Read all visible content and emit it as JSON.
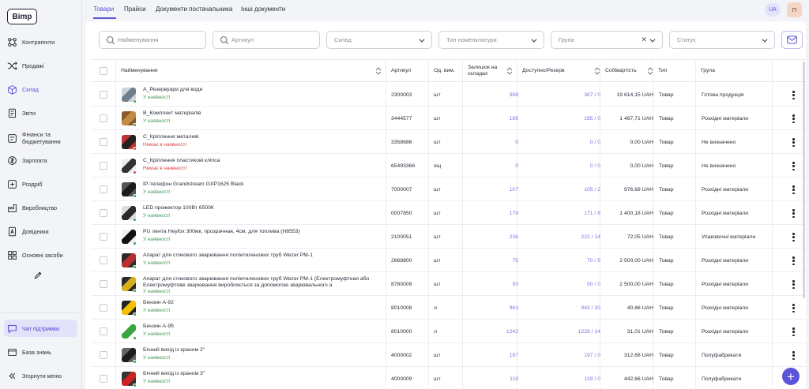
{
  "app": {
    "logo": "Bimp"
  },
  "sidebar": {
    "items": [
      {
        "label": "Контрагенти",
        "icon": "users-network-icon"
      },
      {
        "label": "Продажі",
        "icon": "shuffle-icon"
      },
      {
        "label": "Склад",
        "icon": "box-icon"
      },
      {
        "label": "Звіти",
        "icon": "report-icon"
      },
      {
        "label": "Фінанси та бюджетування",
        "icon": "finance-icon"
      },
      {
        "label": "Зарплата",
        "icon": "salary-icon"
      },
      {
        "label": "Роздріб",
        "icon": "retail-icon"
      },
      {
        "label": "Виробництво",
        "icon": "production-icon"
      },
      {
        "label": "Довідники",
        "icon": "directory-icon"
      },
      {
        "label": "Основні засоби",
        "icon": "assets-icon"
      }
    ],
    "bottom": [
      {
        "label": "Чат підтримки",
        "icon": "chat-icon"
      },
      {
        "label": "База знань",
        "icon": "knowledge-icon"
      },
      {
        "label": "Згорнути меню",
        "icon": "collapse-icon"
      }
    ]
  },
  "tabs": [
    "Товари",
    "Прайси",
    "Документи постачальника",
    "Інші документи"
  ],
  "header": {
    "lang": "UA",
    "avatar": "П"
  },
  "filters": {
    "name_placeholder": "Найменування",
    "sku_placeholder": "Артикул",
    "warehouse": "Склад",
    "nomenclature_type": "Тип номенклатури",
    "group": "Група",
    "status": "Статус"
  },
  "columns": {
    "name": "Найменування",
    "sku": "Артикул",
    "unit": "Од. вим.",
    "stock": "Залишок на складах",
    "available": "Доступно/Резерв",
    "cost": "Собівартість",
    "type": "Тип",
    "group": "Група"
  },
  "rows": [
    {
      "name": "A_Резервуари для води",
      "name2": "",
      "status": "У наявності",
      "in_stock": true,
      "sku": "2300003",
      "unit": "шт",
      "stock": "388",
      "avail": "387 / 0",
      "cost": "19 614,15 UAH",
      "type": "Товар",
      "group": "Готова продукція"
    },
    {
      "name": "B_Комплект матеріалів",
      "name2": "",
      "status": "У наявності",
      "in_stock": true,
      "sku": "3444577",
      "unit": "шт",
      "stock": "185",
      "avail": "185 / 0",
      "cost": "1 467,71 UAH",
      "type": "Товар",
      "group": "Розхідні матеріали"
    },
    {
      "name": "C_Кріплення металеві",
      "name2": "",
      "status": "Немає в наявності",
      "in_stock": false,
      "sku": "3358686",
      "unit": "шт",
      "stock": "0",
      "avail": "0 / 0",
      "cost": "0,00 UAH",
      "type": "Товар",
      "group": "Не визначено"
    },
    {
      "name": "C_Кріплення пластикові кліпса",
      "name2": "",
      "status": "Немає в наявності",
      "in_stock": false,
      "sku": "65493366",
      "unit": "ящ",
      "stock": "0",
      "avail": "0 / 0",
      "cost": "0,00 UAH",
      "type": "Товар",
      "group": "Не визначено"
    },
    {
      "name": "IP-телефон Grandstream GXP1625 Black",
      "name2": "",
      "status": "У наявності",
      "in_stock": true,
      "sku": "7000007",
      "unit": "шт",
      "stock": "107",
      "avail": "105 / 2",
      "cost": "976,68 UAH",
      "type": "Товар",
      "group": "Розхідні матеріали"
    },
    {
      "name": "LED прожектор 100Вт 6500К",
      "name2": "",
      "status": "У наявності",
      "in_stock": true,
      "sku": "0007850",
      "unit": "шт",
      "stock": "179",
      "avail": "171 / 8",
      "cost": "1 400,18 UAH",
      "type": "Товар",
      "group": "Розхідні матеріали"
    },
    {
      "name": "PU лента Heyfox 300мк, прозрачная, 4см, для топлива (H8553)",
      "name2": "",
      "status": "У наявності",
      "in_stock": true,
      "sku": "2100051",
      "unit": "шт",
      "stock": "236",
      "avail": "222 / 14",
      "cost": "72,05 UAH",
      "type": "Товар",
      "group": "Упаковочні матеріали"
    },
    {
      "name": "Апарат для стикового зварювання поліетиленових труб Wezer PM-1",
      "name2": "",
      "status": "У наявності",
      "in_stock": true,
      "sku": "2668800",
      "unit": "шт",
      "stock": "75",
      "avail": "70 / 5",
      "cost": "2 500,00 UAH",
      "type": "Товар",
      "group": "Розхідні матеріали"
    },
    {
      "name": "Апарат для стикового зварювання поліетиленових труб Wezer PM-1 (Електромуфтная або",
      "name2": "Електромуфтове зварювання виробляється за допомогою зварювального а",
      "status": "У наявності",
      "in_stock": true,
      "sku": "8780009",
      "unit": "шт",
      "stock": "50",
      "avail": "50 / 0",
      "cost": "2 500,00 UAH",
      "type": "Товар",
      "group": "Розхідні матеріали"
    },
    {
      "name": "Бензин А-92",
      "name2": "",
      "status": "У наявності",
      "in_stock": true,
      "sku": "8010008",
      "unit": "л",
      "stock": "963",
      "avail": "943 / 20",
      "cost": "40,86 UAH",
      "type": "Товар",
      "group": "Розхідні матеріали"
    },
    {
      "name": "Бензин А-95",
      "name2": "",
      "status": "У наявності",
      "in_stock": true,
      "sku": "8010000",
      "unit": "л",
      "stock": "1242",
      "avail": "1228 / 14",
      "cost": "31,01 UAH",
      "type": "Товар",
      "group": "Розхідні матеріали"
    },
    {
      "name": "Бічний вихід із краном 2\"",
      "name2": "",
      "status": "У наявності",
      "in_stock": true,
      "sku": "4000002",
      "unit": "шт",
      "stock": "197",
      "avail": "197 / 0",
      "cost": "312,68 UAH",
      "type": "Товар",
      "group": "Полуфабрикати"
    },
    {
      "name": "Бічний вихід із краном 3\"",
      "name2": "",
      "status": "У наявності",
      "in_stock": true,
      "sku": "4000009",
      "unit": "шт",
      "stock": "119",
      "avail": "119 / 0",
      "cost": "442,66 UAH",
      "type": "Товар",
      "group": "Полуфабрикати"
    }
  ],
  "colors": {
    "accent": "#5a54d8",
    "in_stock": "#3d9b56",
    "out_of_stock": "#d84545"
  }
}
